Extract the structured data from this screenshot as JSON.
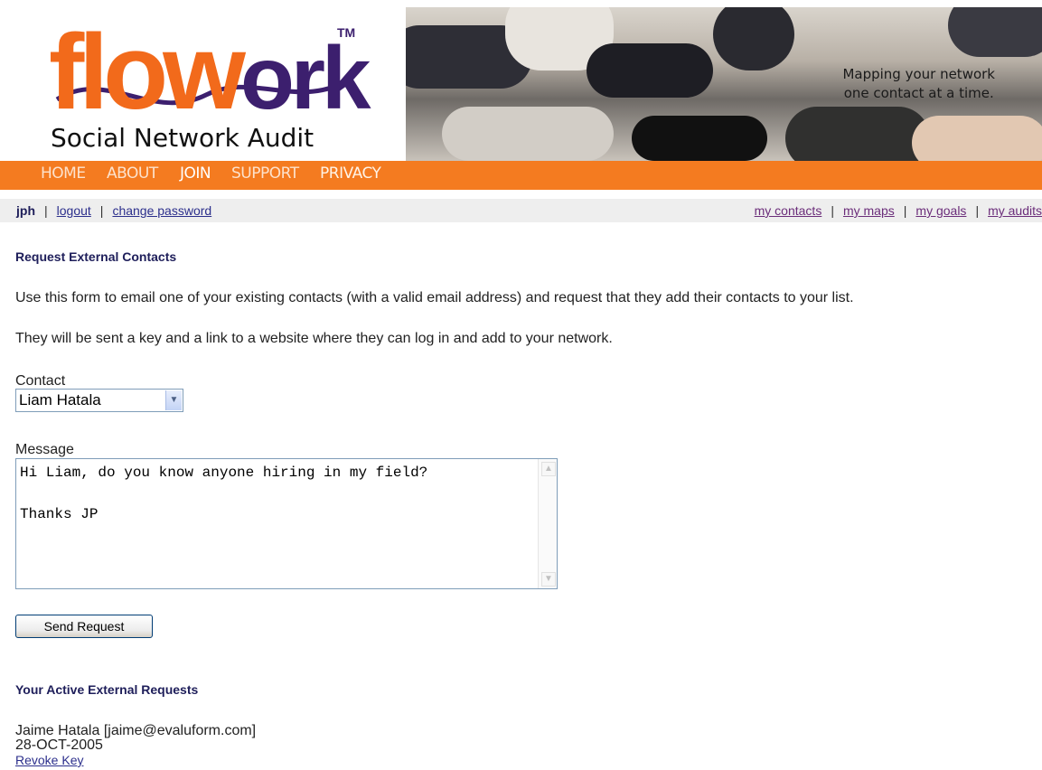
{
  "brand": {
    "logo_main": "flowork",
    "logo_prefix": "flo",
    "logo_suffix": "ork",
    "logo_tm": "TM",
    "subtitle": "Social Network Audit",
    "tagline_line1": "Mapping your network",
    "tagline_line2": "one contact at a time.",
    "orange": "#f47b20",
    "purple": "#3c1f6e"
  },
  "nav": {
    "home": "HOME",
    "about": "ABOUT",
    "join": "JOIN",
    "support": "SUPPORT",
    "privacy": "PRIVACY"
  },
  "userbar": {
    "username": "jph",
    "sep": "|",
    "logout": "logout",
    "change_password": "change password",
    "my_contacts": "my contacts",
    "my_maps": "my maps",
    "my_goals": "my goals",
    "my_audits": "my audits"
  },
  "form": {
    "heading": "Request External Contacts",
    "intro1": "Use this form to email one of your existing contacts (with a valid email address) and request that they add their contacts to your list.",
    "intro2": "They will be sent a key and a link to a website where they can log in and add to your network.",
    "contact_label": "Contact",
    "contact_value": "Liam Hatala",
    "message_label": "Message",
    "message_value": "Hi Liam, do you know anyone hiring in my field?\n\nThanks JP",
    "submit": "Send Request"
  },
  "active": {
    "heading": "Your Active External Requests",
    "requests": [
      {
        "who": "Jaime Hatala [jaime@evaluform.com]",
        "date": "28-OCT-2005",
        "action": "Revoke Key"
      }
    ]
  }
}
